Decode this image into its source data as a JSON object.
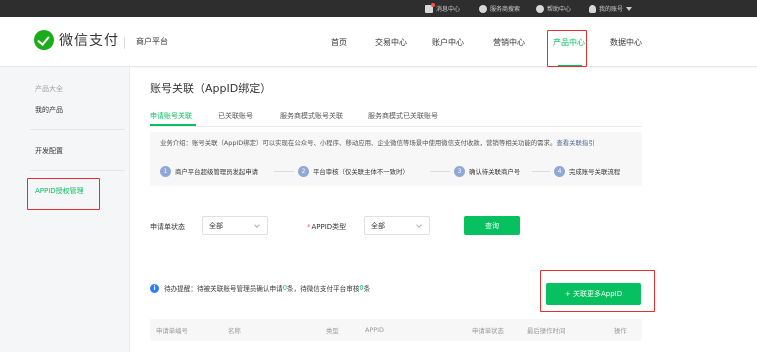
{
  "topbar": {
    "messages": "消息中心",
    "service_search": "服务商搜索",
    "help": "帮助中心",
    "account": "我的账号"
  },
  "header": {
    "brand": "微信支付",
    "platform": "商户平台",
    "nav": [
      "首页",
      "交易中心",
      "账户中心",
      "营销中心",
      "产品中心",
      "数据中心"
    ],
    "active_nav": "产品中心",
    "accent_color": "#07c160",
    "annotation_color": "#e03030"
  },
  "sidebar": {
    "section": "产品大全",
    "my_products": "我的产品",
    "dev_config": "开发配置",
    "appid_auth": "APPID授权管理"
  },
  "main": {
    "title": "账号关联（AppID绑定）",
    "tabs": [
      "申请账号关联",
      "已关联账号",
      "服务商模式账号关联",
      "服务商模式已关联账号"
    ],
    "intro": "业务介绍：账号关联（AppID绑定）可以实现在公众号、小程序、移动应用、企业微信等场景中使用微信支付收款，营销等相关功能的需求。",
    "intro_link": "查看关联指引",
    "steps": [
      {
        "num": "1",
        "label": "商户平台超级管理员发起申请"
      },
      {
        "num": "2",
        "label": "平台审核（仅关联主体不一致时）"
      },
      {
        "num": "3",
        "label": "确认待关联商户号"
      },
      {
        "num": "4",
        "label": "完成账号关联流程"
      }
    ],
    "filters": {
      "status_label": "申请单状态",
      "status_value": "全部",
      "type_label": "APPID类型",
      "type_value": "全部",
      "query_button": "查询"
    },
    "notice": {
      "prefix": "待办提醒：待被关联账号管理员确认申请",
      "count1": "0",
      "middle": "条，待微信支付平台审核",
      "count2": "0",
      "suffix": "条"
    },
    "add_button": "+ 关联更多AppID",
    "table_headers": [
      "申请单编号",
      "名称",
      "类型",
      "APPID",
      "申请单状态",
      "最后操作时间",
      "操作"
    ]
  }
}
